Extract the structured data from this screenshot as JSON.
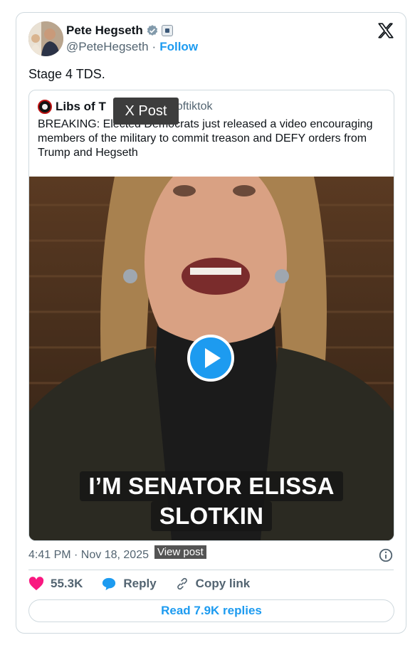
{
  "author": {
    "display_name": "Pete Hegseth",
    "handle": "@PeteHegseth",
    "separator": "·",
    "follow_label": "Follow"
  },
  "tweet": {
    "text": "Stage 4 TDS."
  },
  "quote": {
    "display_name": "Libs of T",
    "handle": "libsoftiktok",
    "text": "BREAKING: Elected Democrats just released a video encouraging members of the military to commit treason and DEFY orders from Trump and Hegseth",
    "tooltip": "X Post",
    "video_caption_line1": "I’M SENATOR ELISSA",
    "video_caption_line2": "SLOTKIN"
  },
  "meta": {
    "timestamp": "4:41 PM · Nov 18, 2025",
    "view_post_label": "View post"
  },
  "actions": {
    "like_count": "55.3K",
    "reply_label": "Reply",
    "copy_link_label": "Copy link"
  },
  "read_replies_label": "Read 7.9K replies",
  "colors": {
    "accent": "#1d9bf0",
    "like": "#f91880",
    "border": "#cfd9de",
    "muted": "#536471"
  },
  "icons": [
    "verified-badge-icon",
    "affiliation-icon",
    "x-logo-icon",
    "play-icon",
    "info-icon",
    "heart-icon",
    "reply-bubble-icon",
    "link-icon"
  ]
}
